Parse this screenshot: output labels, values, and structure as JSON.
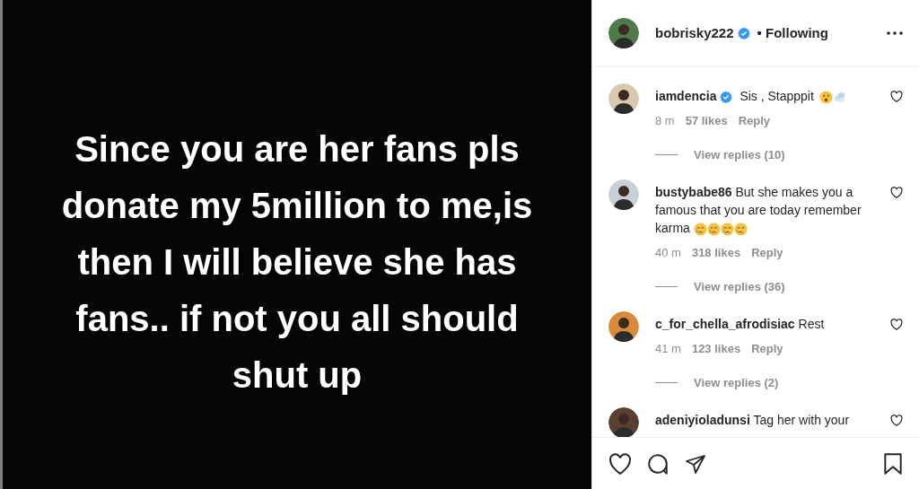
{
  "post": {
    "text": "Since you are her fans pls donate my 5million to me,is then I will believe she has fans.. if not you all should shut up"
  },
  "header": {
    "username": "bobrisky222",
    "verified": true,
    "follow": "• Following"
  },
  "comments": [
    {
      "username": "iamdencia",
      "verified": true,
      "text": "Sis , Stapppit",
      "time": "8 m",
      "likes": "57 likes",
      "reply": "Reply",
      "replies": "View replies (10)"
    },
    {
      "username": "bustybabe86",
      "text": "But she makes you a famous that you are today remember karma",
      "time": "40 m",
      "likes": "318 likes",
      "reply": "Reply",
      "replies": "View replies (36)"
    },
    {
      "username": "c_for_chella_afrodisiac",
      "text": "Rest",
      "time": "41 m",
      "likes": "123 likes",
      "reply": "Reply",
      "replies": "View replies (2)"
    },
    {
      "username": "adeniyioladunsi",
      "text": "Tag her with your"
    }
  ]
}
